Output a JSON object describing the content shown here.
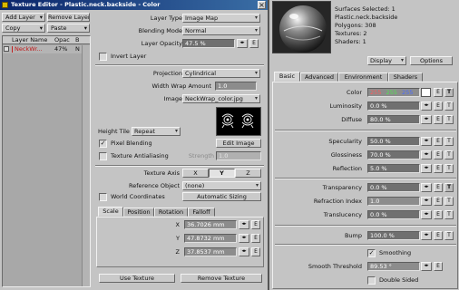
{
  "left_window": {
    "title": "Texture Editor - Plastic.neck.backside - Color",
    "add_layer": "Add Layer",
    "remove_layer": "Remove Layer",
    "copy": "Copy",
    "paste": "Paste",
    "col_name": "Layer Name",
    "col_opac": "Opac",
    "col_b": "B",
    "layer_name": "NeckWr...",
    "layer_opac": "47%",
    "layer_b": "N",
    "layer_type_label": "Layer Type",
    "layer_type": "Image Map",
    "blending_mode_label": "Blending Mode",
    "blending_mode": "Normal",
    "layer_opacity_label": "Layer Opacity",
    "layer_opacity": "47.5 %",
    "invert_layer": "Invert Layer",
    "projection_label": "Projection",
    "projection": "Cylindrical",
    "width_wrap_label": "Width Wrap Amount",
    "width_wrap": "1.0",
    "image_label": "Image",
    "image": "NeckWrap_color.jpg",
    "height_tile_label": "Height Tile",
    "height_tile": "Repeat",
    "pixel_blending": "Pixel Blending",
    "texture_antialiasing": "Texture Antialiasing",
    "strength_label": "Strength",
    "strength": "1.0",
    "edit_image": "Edit Image",
    "texture_axis_label": "Texture Axis",
    "axes": [
      "X",
      "Y",
      "Z"
    ],
    "reference_object_label": "Reference Object",
    "reference_object": "(none)",
    "world_coordinates": "World Coordinates",
    "automatic_sizing": "Automatic Sizing",
    "tabs": [
      "Scale",
      "Position",
      "Rotation",
      "Falloff"
    ],
    "scale_x_label": "X",
    "scale_x": "36.7026 mm",
    "scale_y_label": "Y",
    "scale_y": "47.8732 mm",
    "scale_z_label": "Z",
    "scale_z": "37.8537 mm",
    "use_texture": "Use Texture",
    "remove_texture": "Remove Texture"
  },
  "right_panel": {
    "info": [
      "Surfaces Selected: 1",
      "Plastic.neck.backside",
      "Polygons: 308",
      "Textures: 2",
      "Shaders: 1"
    ],
    "display": "Display",
    "options": "Options",
    "tabs": [
      "Basic",
      "Advanced",
      "Environment",
      "Shaders"
    ],
    "color_label": "Color",
    "color_r": "255",
    "color_g": "255",
    "color_b": "255",
    "luminosity_label": "Luminosity",
    "luminosity": "0.0 %",
    "diffuse_label": "Diffuse",
    "diffuse": "80.0 %",
    "specularity_label": "Specularity",
    "specularity": "50.0 %",
    "glossiness_label": "Glossiness",
    "glossiness": "70.0 %",
    "reflection_label": "Reflection",
    "reflection": "5.0 %",
    "transparency_label": "Transparency",
    "transparency": "0.0 %",
    "refraction_label": "Refraction Index",
    "refraction": "1.0",
    "translucency_label": "Translucency",
    "translucency": "0.0 %",
    "bump_label": "Bump",
    "bump": "100.0 %",
    "smoothing": "Smoothing",
    "smooth_threshold_label": "Smooth Threshold",
    "smooth_threshold": "89.53 °",
    "double_sided": "Double Sided"
  },
  "icons": {
    "env": "E",
    "tex": "T",
    "arrows": "◂▸",
    "close": "×",
    "dropdown": "▾",
    "check": "✓",
    "scroll_up": "▲",
    "scroll_down": "▼"
  },
  "colors": {
    "titlebar": "#0a246a",
    "color_r": "#d03030",
    "color_g": "#30a030",
    "color_b": "#2050c0",
    "swatch": "#ffffff"
  }
}
